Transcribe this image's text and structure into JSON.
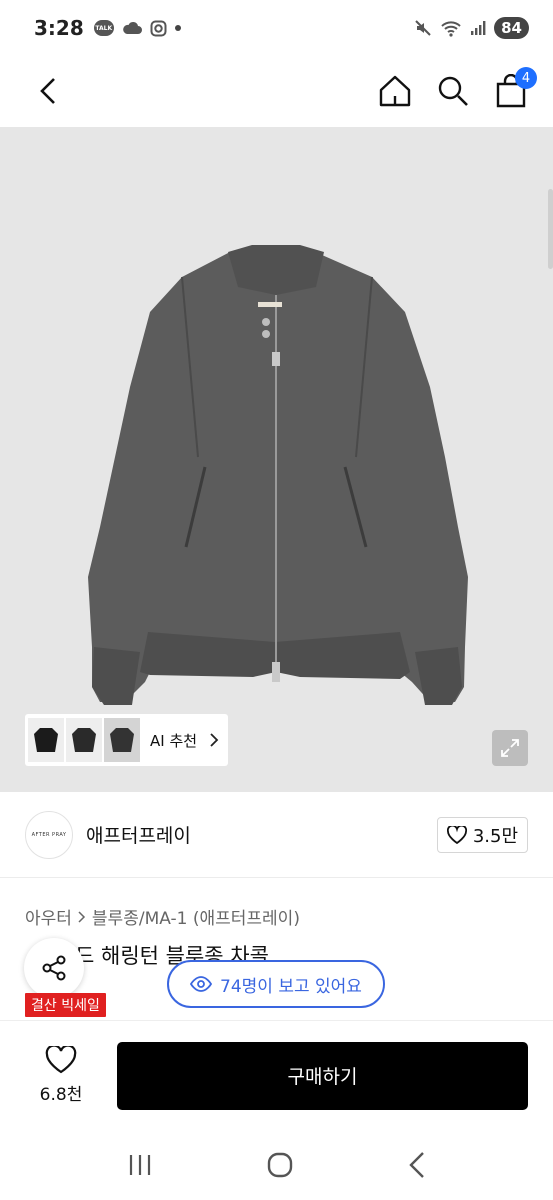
{
  "status_bar": {
    "time": "3:28",
    "battery": "84",
    "icons": [
      "kakaotalk-icon",
      "cloud-icon",
      "instagram-icon",
      "dot-icon",
      "mute-icon",
      "wifi-icon",
      "signal-icon"
    ]
  },
  "header": {
    "back_icon": "chevron-left-icon",
    "home_icon": "home-icon",
    "search_icon": "search-icon",
    "cart_icon": "shopping-bag-icon",
    "cart_count": "4"
  },
  "hero": {
    "image": "gray wool jacket product photo",
    "ai_label": "AI 추천",
    "expand_icon": "expand-icon"
  },
  "brand": {
    "logo_text": "AFTER PRAY",
    "name": "애프터프레이",
    "likes": "3.5만"
  },
  "breadcrumb": {
    "category": "아우터",
    "subcategory": "블루종/MA-1 (애프터프레이)"
  },
  "product": {
    "title": "드 해링턴 블루종 차콜",
    "sale_badge": "결산 빅세일",
    "viewers": "74명이 보고 있어요"
  },
  "buy_bar": {
    "wish_count": "6.8천",
    "buy_label": "구매하기"
  },
  "colors": {
    "accent_blue": "#3a66e0",
    "badge_blue": "#1e6fff",
    "sale_red": "#e02020",
    "buy_black": "#000000"
  }
}
